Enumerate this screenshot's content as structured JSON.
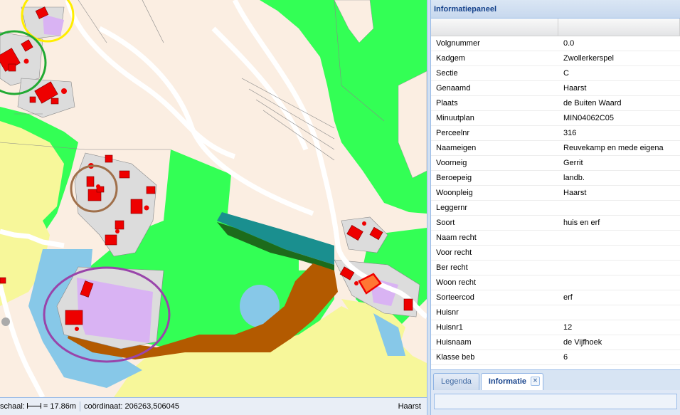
{
  "panel": {
    "title": "Informatiepaneel",
    "rows": [
      {
        "key": "Volgnummer",
        "value": "0.0"
      },
      {
        "key": "Kadgem",
        "value": "Zwollerkerspel"
      },
      {
        "key": "Sectie",
        "value": "C"
      },
      {
        "key": "Genaamd",
        "value": "Haarst"
      },
      {
        "key": "Plaats",
        "value": "de Buiten Waard"
      },
      {
        "key": "Minuutplan",
        "value": "MIN04062C05"
      },
      {
        "key": "Perceelnr",
        "value": "316"
      },
      {
        "key": "Naameigen",
        "value": "Reuvekamp en mede eigena"
      },
      {
        "key": "Voorneig",
        "value": "Gerrit"
      },
      {
        "key": "Beroepeig",
        "value": "landb."
      },
      {
        "key": "Woonpleig",
        "value": "Haarst"
      },
      {
        "key": "Leggernr",
        "value": ""
      },
      {
        "key": "Soort",
        "value": "huis en erf"
      },
      {
        "key": "Naam recht",
        "value": ""
      },
      {
        "key": "Voor recht",
        "value": ""
      },
      {
        "key": "Ber recht",
        "value": ""
      },
      {
        "key": "Woon recht",
        "value": ""
      },
      {
        "key": "Sorteercod",
        "value": "erf"
      },
      {
        "key": "Huisnr",
        "value": ""
      },
      {
        "key": "Huisnr1",
        "value": "12"
      },
      {
        "key": "Huisnaam",
        "value": "de Vijfhoek"
      },
      {
        "key": "Klasse beb",
        "value": "6"
      }
    ]
  },
  "tabs": [
    {
      "label": "Legenda"
    },
    {
      "label": "Informatie"
    }
  ],
  "status": {
    "scale_label": "schaal:",
    "scale_value": "= 17.86m",
    "coord_label": "coördinaat: 206263,506045",
    "place": "Haarst"
  },
  "map": {
    "colors": {
      "grassland": "#33ff55",
      "parcel": "#fbeee2",
      "yard": "#dcdcdc",
      "building": "#ee0000",
      "farmland": "#f7f79a",
      "water": "#87c8e8",
      "purple_area": "#d9b3f3",
      "dark_green": "#1d6b1b",
      "teal": "#1a8f8f",
      "brown": "#b35a00",
      "road": "#ffffff"
    },
    "marker_colors": [
      "#ffee00",
      "#22aa33",
      "#a0704b",
      "#9944aa"
    ]
  }
}
